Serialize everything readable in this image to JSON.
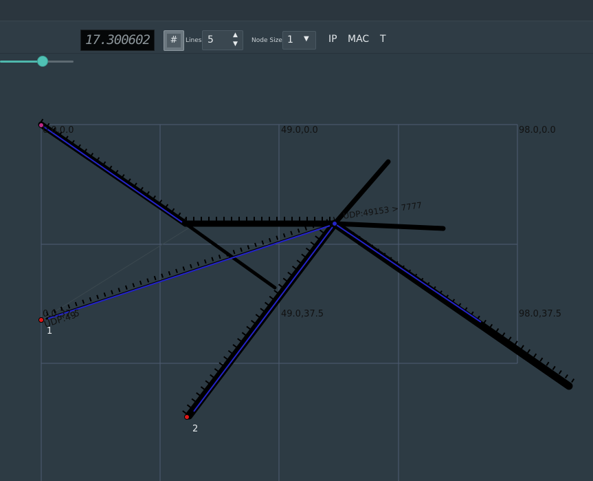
{
  "toolbar": {
    "time_value": "17.300602",
    "grid_icon": "grid-hash-icon",
    "lines_label": "Lines",
    "lines_value": "5",
    "node_size_label": "Node Size",
    "node_size_value": "1",
    "ip_label": "IP",
    "mac_label": "MAC",
    "t_label": "T"
  },
  "canvas": {
    "axis_labels": {
      "a": "0.0,0.0",
      "b": "49.0,0.0",
      "c": "98.0,0.0",
      "d": "0.0,37.5",
      "e": "49.0,37.5",
      "f": "98.0,37.5"
    },
    "nodes": [
      {
        "label": "1"
      },
      {
        "label": "2"
      }
    ],
    "packet_text_main": "UDP:49153 > 7777",
    "packet_text_short": "UDP:49"
  },
  "colors": {
    "background": "#2d3b44",
    "grid": "#4e5c73",
    "packet": "#000000",
    "flow": "#2424c8",
    "node": "#e01818",
    "accent": "#4fc1b4"
  }
}
